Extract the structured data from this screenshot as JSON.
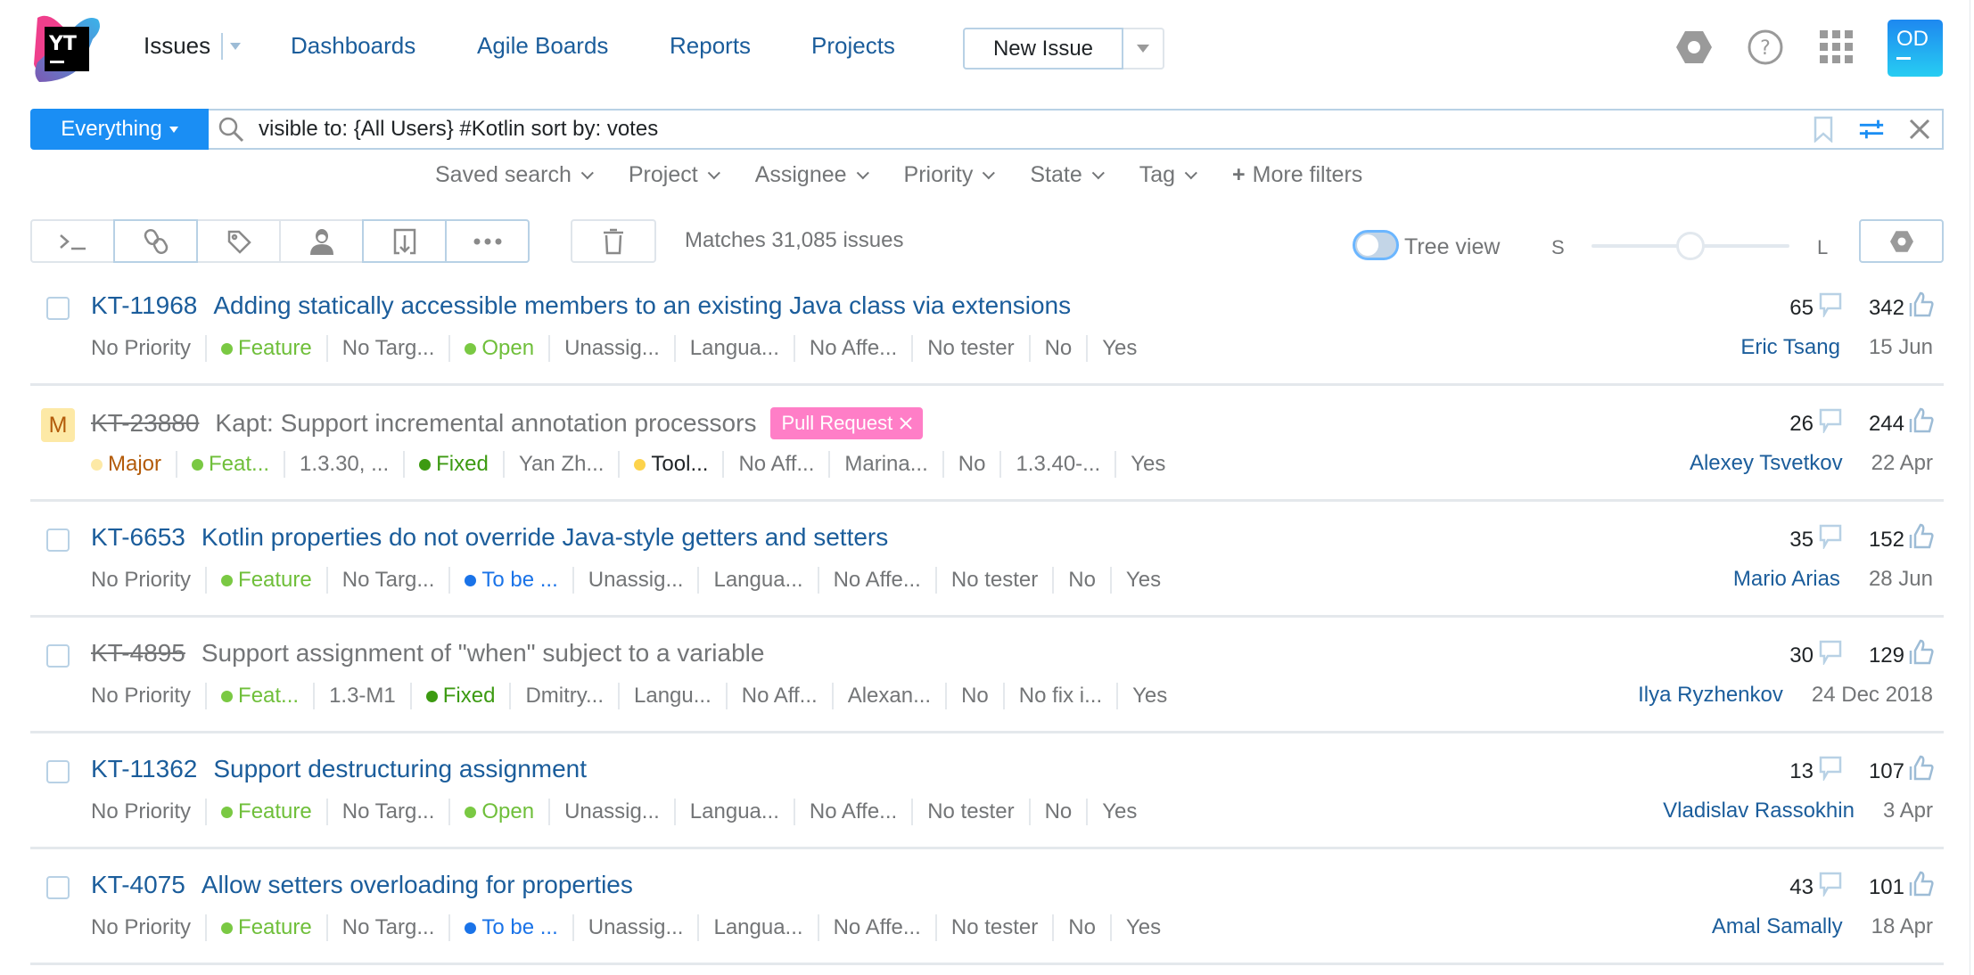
{
  "header": {
    "logo_text": "YT",
    "nav": {
      "issues": "Issues",
      "links": [
        "Dashboards",
        "Agile Boards",
        "Reports",
        "Projects"
      ]
    },
    "new_issue_label": "New Issue",
    "icons": [
      "settings-icon",
      "help-icon",
      "apps-grid-icon"
    ],
    "avatar_initials": "OD"
  },
  "search": {
    "scope_label": "Everything",
    "query": "visible to: {All Users} #Kotlin sort by: votes",
    "tools": [
      "bookmark-icon",
      "filter-settings-icon",
      "clear-icon"
    ]
  },
  "filters": [
    "Saved search",
    "Project",
    "Assignee",
    "Priority",
    "State",
    "Tag"
  ],
  "more_filters_label": "More filters",
  "toolbar": {
    "buttons": [
      "command-icon",
      "link-icon",
      "tag-icon",
      "assignee-icon",
      "export-icon",
      "more-icon"
    ],
    "matches_text": "Matches 31,085 issues",
    "tree_view_label": "Tree view",
    "tree_view_on": false,
    "size_small": "S",
    "size_large": "L",
    "size_level": 0.5
  },
  "colors": {
    "accent": "#1a8ef4",
    "link": "#1b5d9b",
    "feature": "#6fbf3a",
    "open": "#7ac943",
    "fixed": "#3c9a11",
    "to_be_discussed": "#1a73e8",
    "major": "#fde9a6",
    "tool": "#fdd34b",
    "pull_request_tag": "#ff7ec7"
  },
  "issues": [
    {
      "id": "KT-11968",
      "summary": "Adding statically accessible members to an existing Java class via extensions",
      "resolved": false,
      "priority_badge": null,
      "tag": null,
      "fields": [
        {
          "text": "No Priority"
        },
        {
          "text": "Feature",
          "dot": "#7ac943",
          "color": "#6fbf3a"
        },
        {
          "text": "No Targ..."
        },
        {
          "text": "Open",
          "dot": "#7ac943",
          "color": "#6fbf3a"
        },
        {
          "text": "Unassig..."
        },
        {
          "text": "Langua..."
        },
        {
          "text": "No Affe..."
        },
        {
          "text": "No tester"
        },
        {
          "text": "No"
        },
        {
          "text": "Yes"
        }
      ],
      "comments": "65",
      "votes": "342",
      "reporter": "Eric Tsang",
      "date": "15 Jun"
    },
    {
      "id": "KT-23880",
      "summary": "Kapt: Support incremental annotation processors",
      "resolved": true,
      "priority_badge": "M",
      "tag": "Pull Request",
      "fields": [
        {
          "text": "Major",
          "dot": "#fde9a6",
          "color": "#b35b0a"
        },
        {
          "text": "Feat...",
          "dot": "#7ac943",
          "color": "#6fbf3a"
        },
        {
          "text": "1.3.30, ..."
        },
        {
          "text": "Fixed",
          "dot": "#3c9a11",
          "color": "#3c9a11"
        },
        {
          "text": "Yan Zh..."
        },
        {
          "text": "Tool...",
          "dot": "#fdd34b",
          "color": "#1f2326"
        },
        {
          "text": "No Aff..."
        },
        {
          "text": "Marina..."
        },
        {
          "text": "No"
        },
        {
          "text": "1.3.40-..."
        },
        {
          "text": "Yes"
        }
      ],
      "comments": "26",
      "votes": "244",
      "reporter": "Alexey Tsvetkov",
      "date": "22 Apr"
    },
    {
      "id": "KT-6653",
      "summary": "Kotlin properties do not override Java-style getters and setters",
      "resolved": false,
      "priority_badge": null,
      "tag": null,
      "fields": [
        {
          "text": "No Priority"
        },
        {
          "text": "Feature",
          "dot": "#7ac943",
          "color": "#6fbf3a"
        },
        {
          "text": "No Targ..."
        },
        {
          "text": "To be ...",
          "dot": "#1a73e8",
          "color": "#1a73e8"
        },
        {
          "text": "Unassig..."
        },
        {
          "text": "Langua..."
        },
        {
          "text": "No Affe..."
        },
        {
          "text": "No tester"
        },
        {
          "text": "No"
        },
        {
          "text": "Yes"
        }
      ],
      "comments": "35",
      "votes": "152",
      "reporter": "Mario Arias",
      "date": "28 Jun"
    },
    {
      "id": "KT-4895",
      "summary": "Support assignment of \"when\" subject to a variable",
      "resolved": true,
      "priority_badge": null,
      "tag": null,
      "fields": [
        {
          "text": "No Priority"
        },
        {
          "text": "Feat...",
          "dot": "#7ac943",
          "color": "#6fbf3a"
        },
        {
          "text": "1.3-M1"
        },
        {
          "text": "Fixed",
          "dot": "#3c9a11",
          "color": "#3c9a11"
        },
        {
          "text": "Dmitry..."
        },
        {
          "text": "Langu..."
        },
        {
          "text": "No Aff..."
        },
        {
          "text": "Alexan..."
        },
        {
          "text": "No"
        },
        {
          "text": "No fix i..."
        },
        {
          "text": "Yes"
        }
      ],
      "comments": "30",
      "votes": "129",
      "reporter": "Ilya Ryzhenkov",
      "date": "24 Dec 2018"
    },
    {
      "id": "KT-11362",
      "summary": "Support destructuring assignment",
      "resolved": false,
      "priority_badge": null,
      "tag": null,
      "fields": [
        {
          "text": "No Priority"
        },
        {
          "text": "Feature",
          "dot": "#7ac943",
          "color": "#6fbf3a"
        },
        {
          "text": "No Targ..."
        },
        {
          "text": "Open",
          "dot": "#7ac943",
          "color": "#6fbf3a"
        },
        {
          "text": "Unassig..."
        },
        {
          "text": "Langua..."
        },
        {
          "text": "No Affe..."
        },
        {
          "text": "No tester"
        },
        {
          "text": "No"
        },
        {
          "text": "Yes"
        }
      ],
      "comments": "13",
      "votes": "107",
      "reporter": "Vladislav Rassokhin",
      "date": "3 Apr"
    },
    {
      "id": "KT-4075",
      "summary": "Allow setters overloading for properties",
      "resolved": false,
      "priority_badge": null,
      "tag": null,
      "fields": [
        {
          "text": "No Priority"
        },
        {
          "text": "Feature",
          "dot": "#7ac943",
          "color": "#6fbf3a"
        },
        {
          "text": "No Targ..."
        },
        {
          "text": "To be ...",
          "dot": "#1a73e8",
          "color": "#1a73e8"
        },
        {
          "text": "Unassig..."
        },
        {
          "text": "Langua..."
        },
        {
          "text": "No Affe..."
        },
        {
          "text": "No tester"
        },
        {
          "text": "No"
        },
        {
          "text": "Yes"
        }
      ],
      "comments": "43",
      "votes": "101",
      "reporter": "Amal Samally",
      "date": "18 Apr"
    }
  ]
}
